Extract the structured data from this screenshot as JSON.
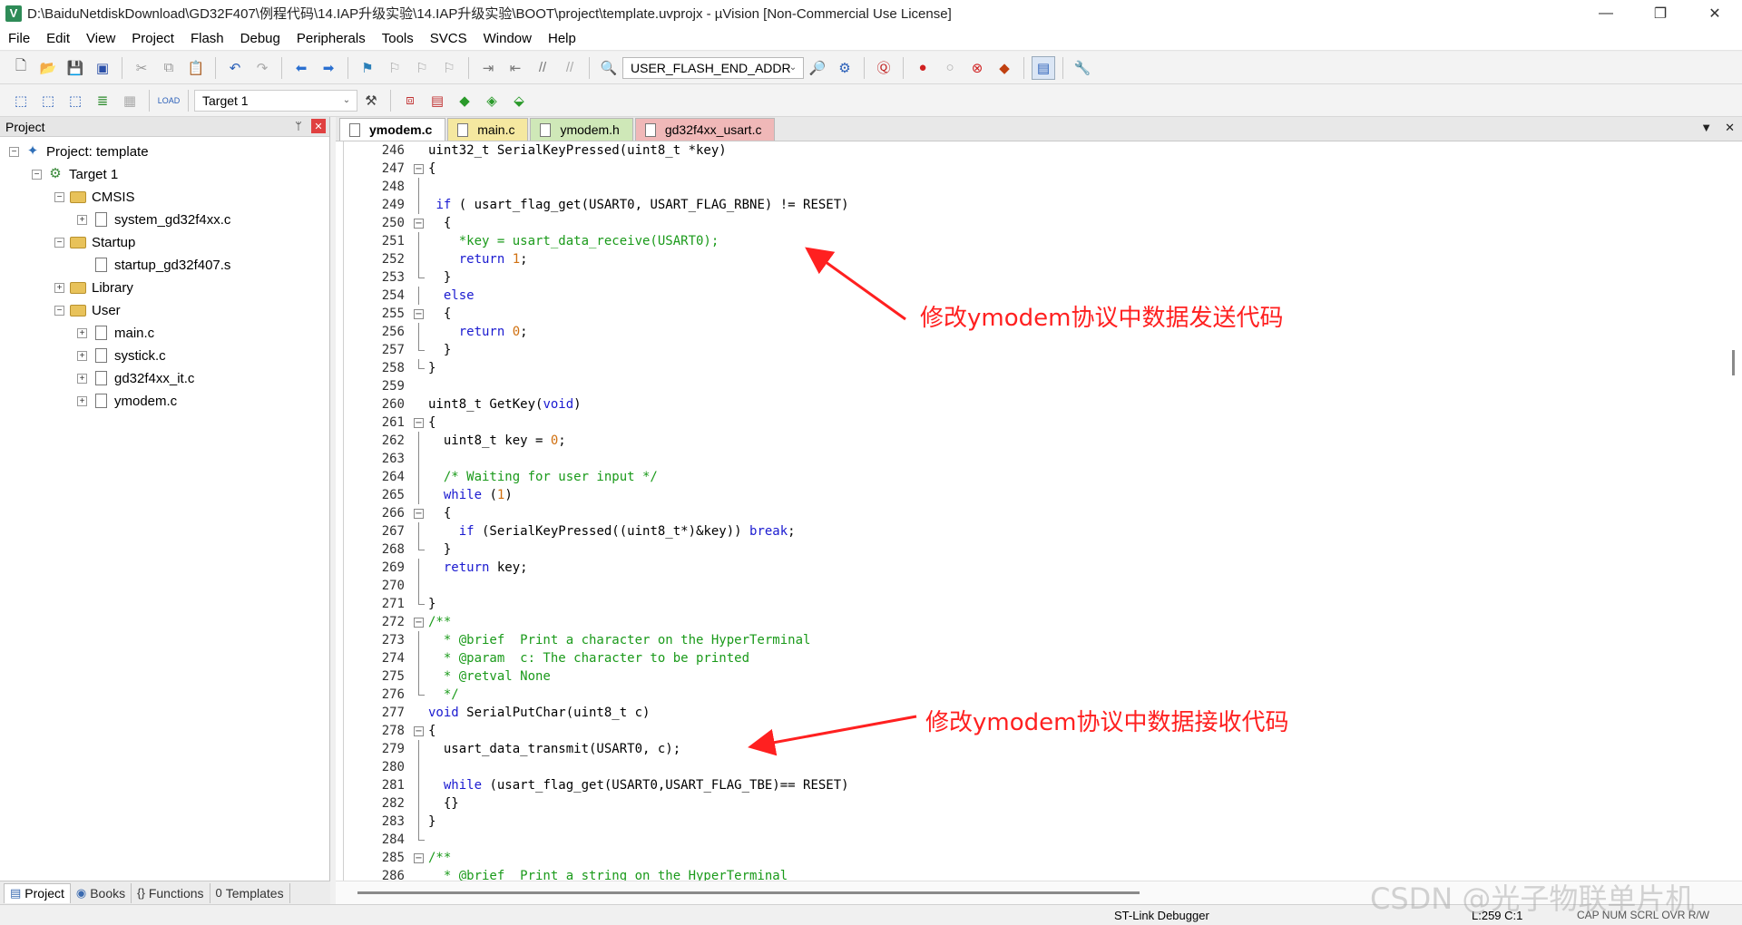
{
  "window": {
    "title": "D:\\BaiduNetdiskDownload\\GD32F407\\例程代码\\14.IAP升级实验\\14.IAP升级实验\\BOOT\\project\\template.uvprojx - µVision  [Non-Commercial Use License]",
    "minimize": "—",
    "restore": "❐",
    "close": "✕"
  },
  "menu": [
    "File",
    "Edit",
    "View",
    "Project",
    "Flash",
    "Debug",
    "Peripherals",
    "Tools",
    "SVCS",
    "Window",
    "Help"
  ],
  "toolbar": {
    "find_combo": "USER_FLASH_END_ADDR",
    "target_combo": "Target 1"
  },
  "project_panel": {
    "header": "Project",
    "pin": "📌",
    "close": "✕",
    "tree": [
      {
        "label": "Project: template",
        "type": "project",
        "expander": "⊟"
      },
      {
        "label": "Target 1",
        "type": "target",
        "expander": "⊟"
      },
      {
        "label": "CMSIS",
        "type": "folder",
        "expander": "⊟"
      },
      {
        "label": "system_gd32f4xx.c",
        "type": "file",
        "expander": "⊞"
      },
      {
        "label": "Startup",
        "type": "folder",
        "expander": "⊟"
      },
      {
        "label": "startup_gd32f407.s",
        "type": "file",
        "expander": ""
      },
      {
        "label": "Library",
        "type": "folder",
        "expander": "⊞"
      },
      {
        "label": "User",
        "type": "folder",
        "expander": "⊟"
      },
      {
        "label": "main.c",
        "type": "file",
        "expander": "⊞"
      },
      {
        "label": "systick.c",
        "type": "file",
        "expander": "⊞"
      },
      {
        "label": "gd32f4xx_it.c",
        "type": "file",
        "expander": "⊞"
      },
      {
        "label": "ymodem.c",
        "type": "file",
        "expander": "⊞"
      }
    ],
    "bottom_tabs": [
      "Project",
      "Books",
      "Functions",
      "Templates"
    ]
  },
  "editor": {
    "tabs": [
      {
        "label": "ymodem.c",
        "active": true,
        "color": "#ffffff"
      },
      {
        "label": "main.c",
        "active": false,
        "color": "#f5e8a0"
      },
      {
        "label": "ymodem.h",
        "active": false,
        "color": "#cfe8b8"
      },
      {
        "label": "gd32f4xx_usart.c",
        "active": false,
        "color": "#f0b8b8"
      }
    ],
    "tab_menu": "▼",
    "tab_close": "✕",
    "lines": [
      {
        "n": "246",
        "text": "uint32_t SerialKeyPressed(uint8_t *key)"
      },
      {
        "n": "247",
        "text": "{"
      },
      {
        "n": "248",
        "text": ""
      },
      {
        "n": "249",
        "text": " if ( usart_flag_get(USART0, USART_FLAG_RBNE) != RESET)"
      },
      {
        "n": "250",
        "text": "  {"
      },
      {
        "n": "251",
        "text": "    *key = usart_data_receive(USART0);"
      },
      {
        "n": "252",
        "text": "    return 1;"
      },
      {
        "n": "253",
        "text": "  }"
      },
      {
        "n": "254",
        "text": "  else"
      },
      {
        "n": "255",
        "text": "  {"
      },
      {
        "n": "256",
        "text": "    return 0;"
      },
      {
        "n": "257",
        "text": "  }"
      },
      {
        "n": "258",
        "text": "}"
      },
      {
        "n": "259",
        "text": ""
      },
      {
        "n": "260",
        "text": "uint8_t GetKey(void)"
      },
      {
        "n": "261",
        "text": "{"
      },
      {
        "n": "262",
        "text": "  uint8_t key = 0;"
      },
      {
        "n": "263",
        "text": ""
      },
      {
        "n": "264",
        "text": "  /* Waiting for user input */"
      },
      {
        "n": "265",
        "text": "  while (1)"
      },
      {
        "n": "266",
        "text": "  {"
      },
      {
        "n": "267",
        "text": "    if (SerialKeyPressed((uint8_t*)&key)) break;"
      },
      {
        "n": "268",
        "text": "  }"
      },
      {
        "n": "269",
        "text": "  return key;"
      },
      {
        "n": "270",
        "text": ""
      },
      {
        "n": "271",
        "text": "}"
      },
      {
        "n": "272",
        "text": "/**"
      },
      {
        "n": "273",
        "text": "  * @brief  Print a character on the HyperTerminal"
      },
      {
        "n": "274",
        "text": "  * @param  c: The character to be printed"
      },
      {
        "n": "275",
        "text": "  * @retval None"
      },
      {
        "n": "276",
        "text": "  */"
      },
      {
        "n": "277",
        "text": "void SerialPutChar(uint8_t c)"
      },
      {
        "n": "278",
        "text": "{"
      },
      {
        "n": "279",
        "text": "  usart_data_transmit(USART0, c);"
      },
      {
        "n": "280",
        "text": ""
      },
      {
        "n": "281",
        "text": "  while (usart_flag_get(USART0,USART_FLAG_TBE)== RESET)"
      },
      {
        "n": "282",
        "text": "  {}"
      },
      {
        "n": "283",
        "text": "}"
      },
      {
        "n": "284",
        "text": ""
      },
      {
        "n": "285",
        "text": "/**"
      },
      {
        "n": "286",
        "text": "  * @brief  Print a string on the HyperTerminal"
      }
    ]
  },
  "annotations": {
    "send": "修改ymodem协议中数据发送代码",
    "receive": "修改ymodem协议中数据接收代码",
    "color": "#ff2020"
  },
  "status": {
    "debugger": "ST-Link Debugger",
    "position": "L:259 C:1",
    "indicators": "CAP  NUM  SCRL  OVR  R/W"
  },
  "watermark": "CSDN @光子物联单片机"
}
